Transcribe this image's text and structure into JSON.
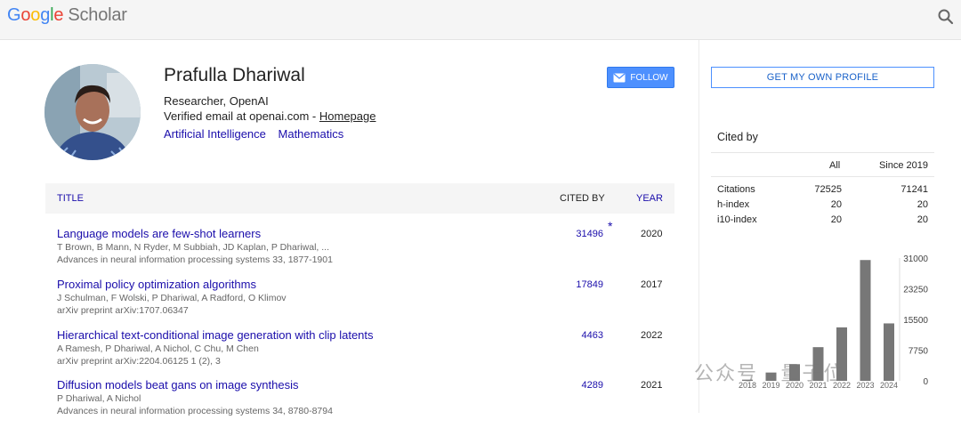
{
  "header": {
    "logo_parts": [
      "G",
      "o",
      "o",
      "g",
      "l",
      "e"
    ],
    "logo_suffix": "Scholar"
  },
  "profile": {
    "name": "Prafulla Dhariwal",
    "affiliation": "Researcher, OpenAI",
    "email_text": "Verified email at openai.com - ",
    "homepage_label": "Homepage",
    "interests": [
      "Artificial Intelligence",
      "Mathematics"
    ],
    "follow_label": "FOLLOW"
  },
  "table": {
    "col_title": "TITLE",
    "col_cited": "CITED BY",
    "col_year": "YEAR",
    "star": "*",
    "rows": [
      {
        "title": "Language models are few-shot learners",
        "authors": "T Brown, B Mann, N Ryder, M Subbiah, JD Kaplan, P Dhariwal, ...",
        "venue": "Advances in neural information processing systems 33, 1877-1901",
        "cited": "31496",
        "year": "2020"
      },
      {
        "title": "Proximal policy optimization algorithms",
        "authors": "J Schulman, F Wolski, P Dhariwal, A Radford, O Klimov",
        "venue": "arXiv preprint arXiv:1707.06347",
        "cited": "17849",
        "year": "2017"
      },
      {
        "title": "Hierarchical text-conditional image generation with clip latents",
        "authors": "A Ramesh, P Dhariwal, A Nichol, C Chu, M Chen",
        "venue": "arXiv preprint arXiv:2204.06125 1 (2), 3",
        "cited": "4463",
        "year": "2022"
      },
      {
        "title": "Diffusion models beat gans on image synthesis",
        "authors": "P Dhariwal, A Nichol",
        "venue": "Advances in neural information processing systems 34, 8780-8794",
        "cited": "4289",
        "year": "2021"
      }
    ]
  },
  "sidebar": {
    "own_profile_label": "GET MY OWN PROFILE",
    "cited_by_label": "Cited by",
    "col_all": "All",
    "col_since": "Since 2019",
    "stats": [
      {
        "label": "Citations",
        "all": "72525",
        "since": "71241"
      },
      {
        "label": "h-index",
        "all": "20",
        "since": "20"
      },
      {
        "label": "i10-index",
        "all": "20",
        "since": "20"
      }
    ]
  },
  "chart_data": {
    "type": "bar",
    "categories": [
      "2018",
      "2019",
      "2020",
      "2021",
      "2022",
      "2023",
      "2024"
    ],
    "values": [
      300,
      2100,
      4200,
      8500,
      13500,
      30500,
      14500
    ],
    "y_ticks": [
      "31000",
      "23250",
      "15500",
      "7750",
      "0"
    ],
    "ylim": [
      0,
      31000
    ],
    "bar_color": "#777777",
    "grid": false
  },
  "watermark": "公众号 · 量子位"
}
